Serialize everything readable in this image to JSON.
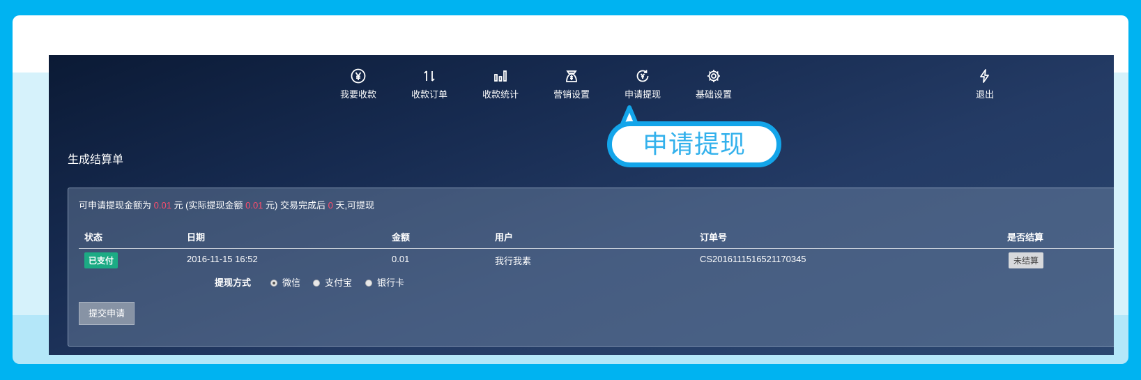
{
  "nav": {
    "items": [
      {
        "label": "我要收款",
        "icon": "yen-circle-icon"
      },
      {
        "label": "收款订单",
        "icon": "sort-arrows-icon"
      },
      {
        "label": "收款统计",
        "icon": "bar-chart-icon"
      },
      {
        "label": "营销设置",
        "icon": "money-bag-icon"
      },
      {
        "label": "申请提现",
        "icon": "withdraw-cycle-icon"
      },
      {
        "label": "基础设置",
        "icon": "gear-icon"
      }
    ],
    "logout": {
      "label": "退出",
      "icon": "lightning-icon"
    }
  },
  "callout": {
    "text": "申请提现"
  },
  "page": {
    "title": "生成结算单"
  },
  "withdraw_info": {
    "prefix": "可申请提现金额为 ",
    "amount": "0.01",
    "mid1": " 元 (实际提现金额 ",
    "actual_amount": "0.01",
    "mid2": " 元) 交易完成后 ",
    "days": "0",
    "suffix": " 天,可提现"
  },
  "table": {
    "headers": {
      "status": "状态",
      "date": "日期",
      "amount": "金额",
      "user": "用户",
      "order_no": "订单号",
      "settled": "是否结算"
    },
    "row": {
      "status": "已支付",
      "date": "2016-11-15 16:52",
      "amount": "0.01",
      "user": "我行我素",
      "order_no": "CS2016111516521170345",
      "settled": "未结算"
    }
  },
  "withdraw_method": {
    "label": "提现方式",
    "options": [
      "微信",
      "支付宝",
      "银行卡"
    ],
    "selected": "微信"
  },
  "submit_label": "提交申请",
  "colors": {
    "accent_red": "#ff4d6d",
    "paid_green": "#1cab84",
    "callout_blue": "#13a5ea"
  }
}
